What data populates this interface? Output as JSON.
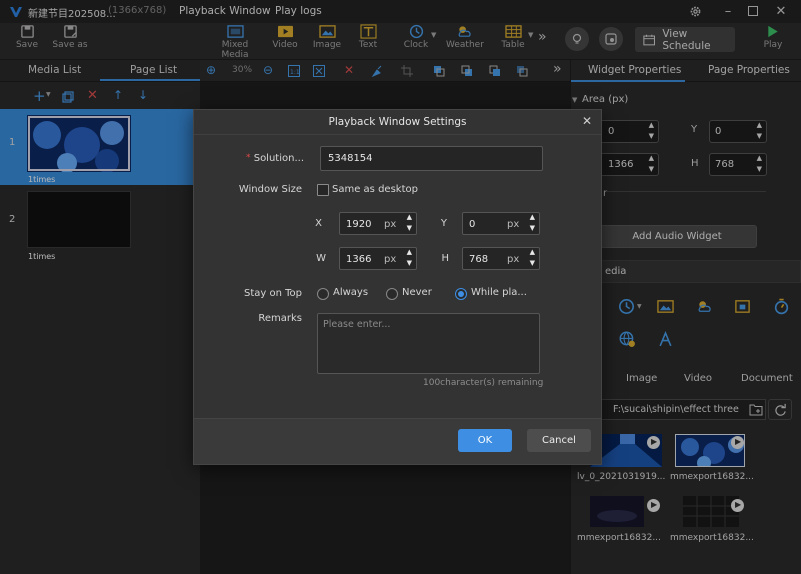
{
  "titlebar": {
    "doc_title": "新建节目202508...",
    "doc_size": "(1366x768)",
    "menus": [
      "Playback Window",
      "Play logs"
    ]
  },
  "toolbar": {
    "save": "Save",
    "save_as": "Save as",
    "mixed_media": "Mixed Media",
    "video": "Video",
    "image": "Image",
    "text": "Text",
    "clock": "Clock",
    "weather": "Weather",
    "table": "Table",
    "view_schedule": "View Schedule",
    "play": "Play"
  },
  "left_panel": {
    "tabs": [
      "Media List",
      "Page List"
    ],
    "slides": [
      {
        "number": "1",
        "times": "1times"
      },
      {
        "number": "2",
        "times": "1times"
      }
    ]
  },
  "canvas_toolbar": {
    "zoom": "30%"
  },
  "right_panel": {
    "tabs": [
      "Widget Properties",
      "Page Properties"
    ],
    "area_label": "Area (px)",
    "x_value": "0",
    "y_label": "Y",
    "y_value": "0",
    "w_value": "1366",
    "h_label": "H",
    "h_value": "768",
    "partial_label": "r",
    "add_audio_widget": "Add Audio Widget",
    "media_header": "edia",
    "media_tabs": [
      "Image",
      "Video",
      "Document"
    ],
    "path": "F:\\sucai\\shipin\\effect three",
    "files": [
      "lv_0_2021031919...",
      "mmexport16832...",
      "mmexport16832...",
      "mmexport16832..."
    ]
  },
  "dialog": {
    "title": "Playback Window Settings",
    "solution_label": "Solution...",
    "solution_value": "5348154",
    "window_size_label": "Window Size",
    "same_as_desktop": "Same as desktop",
    "x_label": "X",
    "x_value": "1920",
    "y_label": "Y",
    "y_value": "0",
    "w_label": "W",
    "w_value": "1366",
    "h_label": "H",
    "h_value": "768",
    "unit": "px",
    "stay_on_top_label": "Stay on Top",
    "stay_options": [
      "Always",
      "Never",
      "While pla..."
    ],
    "stay_selected": "While pla...",
    "remarks_label": "Remarks",
    "remarks_placeholder": "Please enter...",
    "remaining": "100character(s) remaining",
    "ok": "OK",
    "cancel": "Cancel"
  },
  "colors": {
    "accent": "#3e8fe3",
    "required_star": "#e04848"
  }
}
